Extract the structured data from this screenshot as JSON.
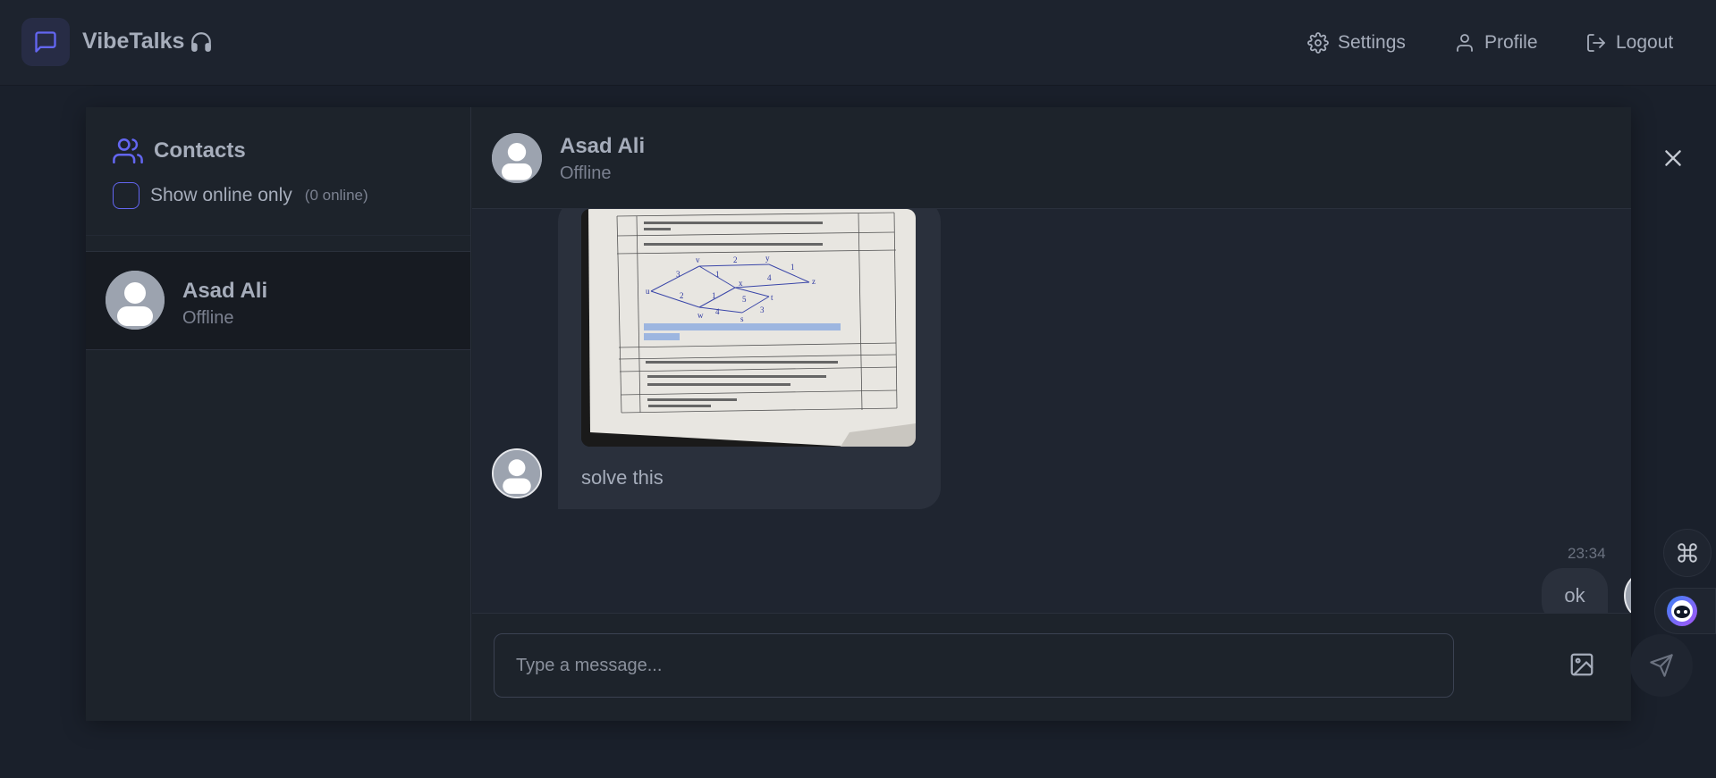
{
  "app": {
    "brand": "VibeTalks",
    "brand_icon": "headphones-icon",
    "accent": "#6366f1"
  },
  "nav": {
    "settings": "Settings",
    "profile": "Profile",
    "logout": "Logout"
  },
  "sidebar": {
    "title": "Contacts",
    "filter_label": "Show online only",
    "online_count": "(0 online)",
    "contacts": [
      {
        "name": "Asad Ali",
        "status": "Offline"
      }
    ]
  },
  "chat": {
    "name": "Asad Ali",
    "status": "Offline",
    "messages": [
      {
        "direction": "incoming",
        "has_image": true,
        "text": "solve this"
      },
      {
        "direction": "outgoing",
        "time": "23:34",
        "text": "ok"
      }
    ]
  },
  "composer": {
    "placeholder": "Type a message..."
  }
}
